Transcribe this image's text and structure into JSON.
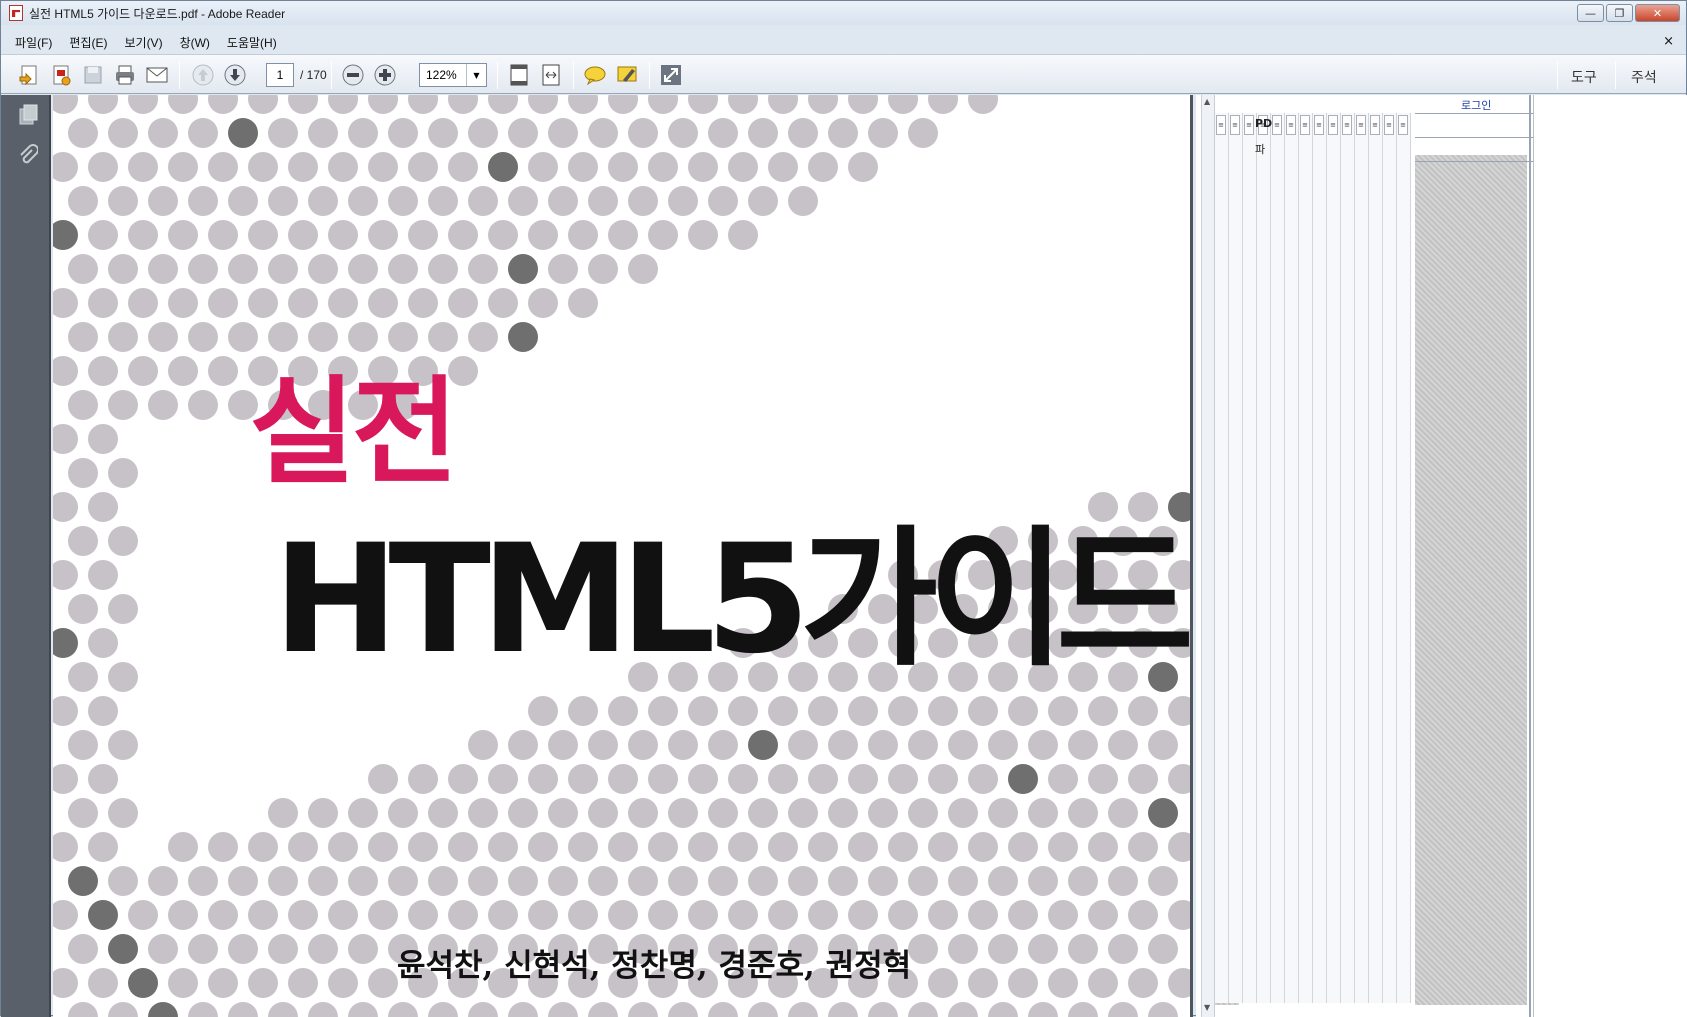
{
  "window": {
    "title": "실전 HTML5 가이드 다운로드.pdf - Adobe Reader"
  },
  "menu": {
    "items": [
      "파일(F)",
      "편집(E)",
      "보기(V)",
      "창(W)",
      "도움말(H)"
    ],
    "close_glyph": "×"
  },
  "toolbar": {
    "current_page": "1",
    "total_pages": "/ 170",
    "zoom": "122%",
    "tools_label": "도구",
    "comment_label": "주석"
  },
  "document": {
    "title_line1": "실전",
    "title_line2": "HTML5가이드",
    "authors": "윤석찬, 신현석, 정찬명, 경준호, 권정혁"
  },
  "right_panel": {
    "login": "로그인",
    "col_texts": [
      "PD",
      "파"
    ]
  },
  "colors": {
    "accent": "#d8185a",
    "dots_light": "#c7c2c7",
    "dots_dark": "#6f6f6f"
  },
  "icons": [
    "pdf-file-icon",
    "create-pdf-icon",
    "export-pdf-icon",
    "save-icon",
    "print-icon",
    "email-icon",
    "prev-page-icon",
    "next-page-icon",
    "zoom-out-icon",
    "zoom-in-icon",
    "fit-page-icon",
    "fit-width-icon",
    "comment-icon",
    "highlight-icon",
    "fullscreen-icon",
    "pages-icon",
    "attachment-icon"
  ]
}
